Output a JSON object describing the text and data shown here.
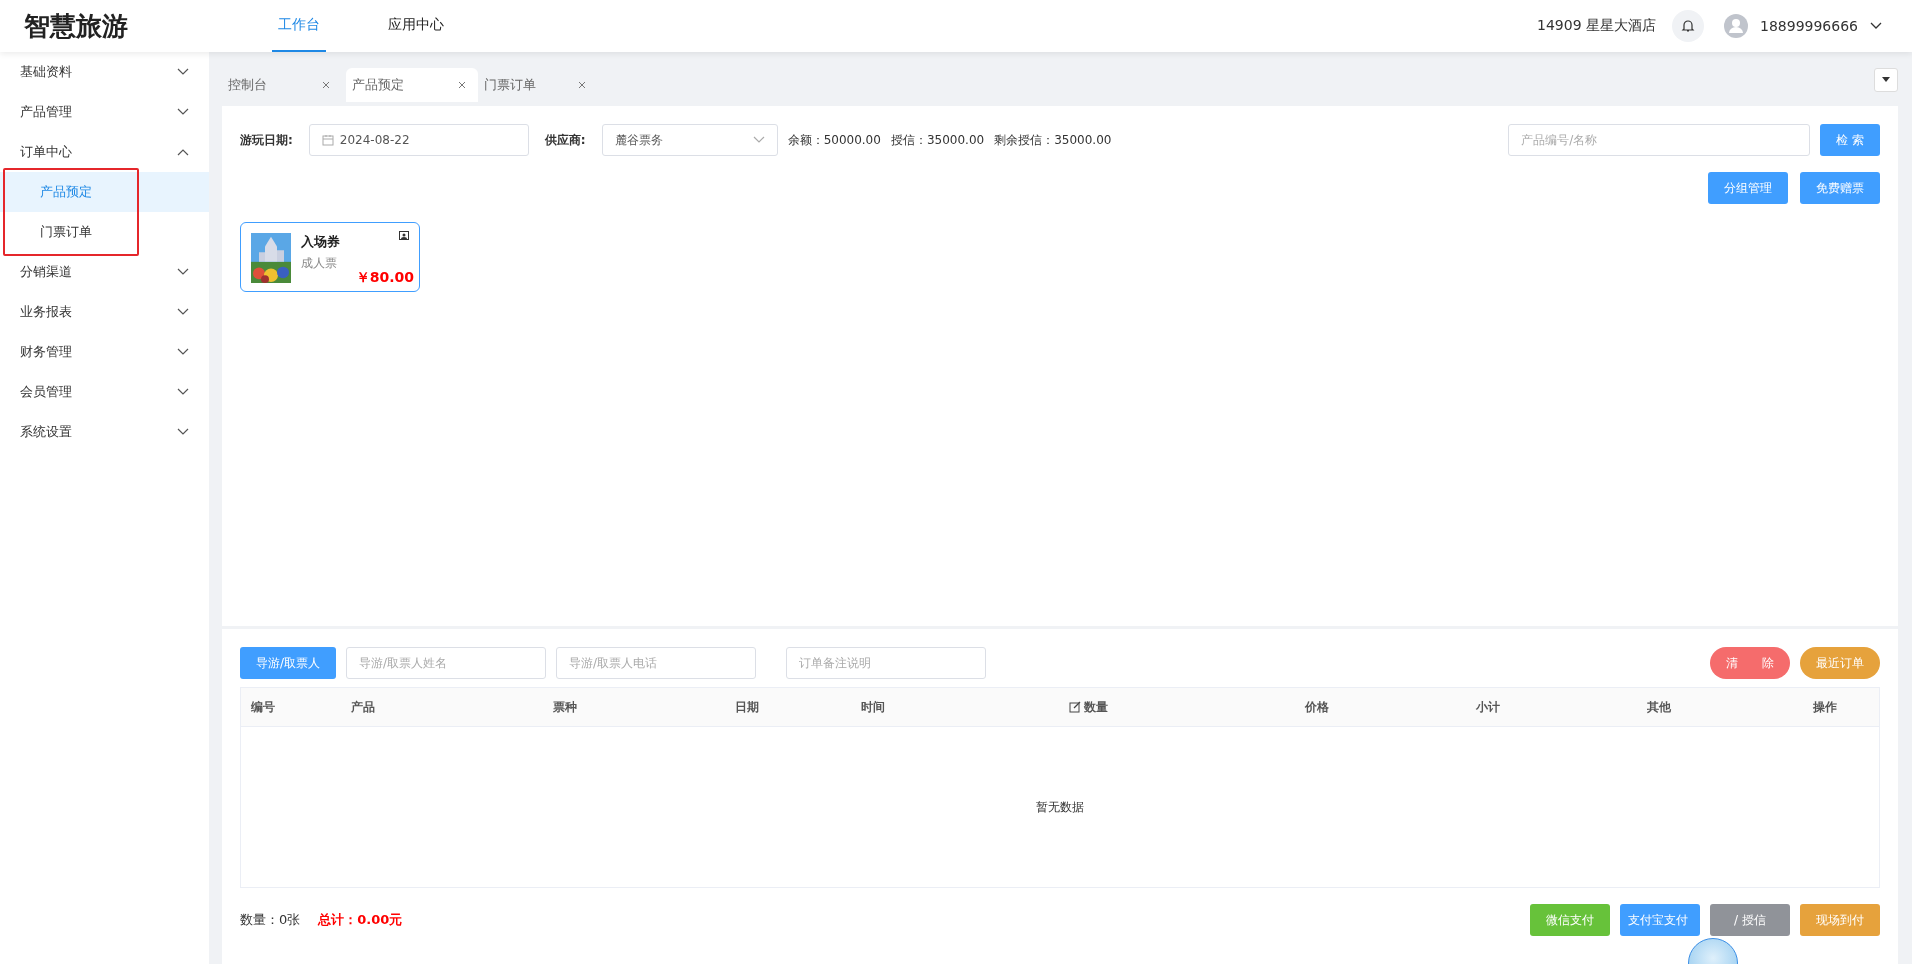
{
  "header": {
    "logo": "智慧旅游",
    "nav": [
      {
        "label": "工作台",
        "selected": true
      },
      {
        "label": "应用中心",
        "selected": false
      }
    ],
    "store": "14909 星星大酒店",
    "user": "18899996666"
  },
  "sidebar": {
    "items": [
      {
        "label": "基础资料",
        "expanded": false
      },
      {
        "label": "产品管理",
        "expanded": false
      },
      {
        "label": "订单中心",
        "expanded": true,
        "children": [
          {
            "label": "产品预定",
            "selected": true
          },
          {
            "label": "门票订单",
            "selected": false
          }
        ]
      },
      {
        "label": "分销渠道",
        "expanded": false
      },
      {
        "label": "业务报表",
        "expanded": false
      },
      {
        "label": "财务管理",
        "expanded": false
      },
      {
        "label": "会员管理",
        "expanded": false
      },
      {
        "label": "系统设置",
        "expanded": false
      }
    ]
  },
  "tabs": [
    {
      "label": "控制台",
      "selected": false
    },
    {
      "label": "产品预定",
      "selected": true
    },
    {
      "label": "门票订单",
      "selected": false
    }
  ],
  "filters": {
    "date_label": "游玩日期:",
    "date": "2024-08-22",
    "supplier_label": "供应商:",
    "supplier": "麓谷票务",
    "balance": "余额：50000.00",
    "credit": "授信：35000.00",
    "remaining": "剩余授信：35000.00",
    "search_placeholder": "产品编号/名称",
    "search_button": "检 索"
  },
  "actions": [
    "分组管理",
    "免费赠票"
  ],
  "products": [
    {
      "name": "入场券",
      "type": "成人票",
      "price": "￥80.00"
    }
  ],
  "order": {
    "guide_button": "导游/取票人",
    "name_placeholder": "导游/取票人姓名",
    "phone_placeholder": "导游/取票人电话",
    "note_placeholder": "订单备注说明",
    "clear_button": "清　　除",
    "recent_button": "最近订单"
  },
  "table": {
    "columns": [
      "编号",
      "产品",
      "票种",
      "日期",
      "时间",
      "数量",
      "价格",
      "小计",
      "其他",
      "操作"
    ],
    "empty": "暂无数据"
  },
  "footer": {
    "quantity": "数量：0张",
    "total": "总计：0.00元",
    "pay_buttons": [
      {
        "label": "微信支付",
        "color": "#67c23a"
      },
      {
        "label": "支付宝支付",
        "color": "#409eff"
      },
      {
        "label": "/ 授信",
        "color": "#909399"
      },
      {
        "label": "现场到付",
        "color": "#e6a23c"
      }
    ]
  }
}
